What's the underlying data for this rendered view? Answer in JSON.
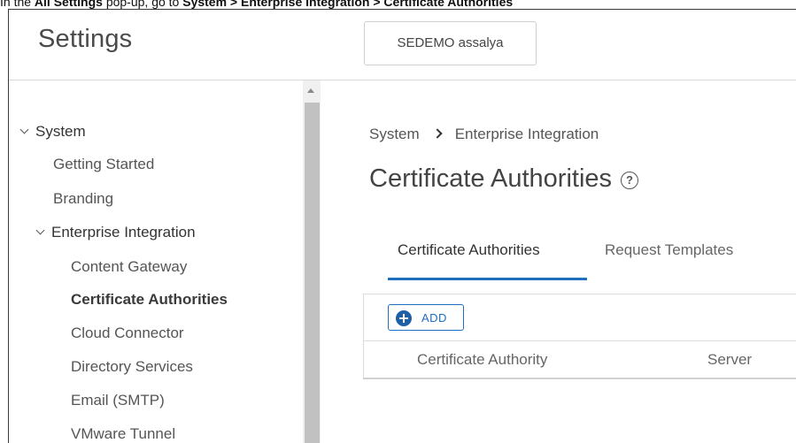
{
  "instruction": {
    "prefix": "In the ",
    "bold1": "All Settings",
    "middle": " pop-up, go to ",
    "bold2": "System > Enterprise Integration > Certificate Authorities"
  },
  "header": {
    "title": "Settings",
    "org_button": "SEDEMO assalya"
  },
  "sidebar": {
    "items": [
      {
        "label": "System",
        "level": 0,
        "expanded": true
      },
      {
        "label": "Getting Started",
        "level": 1
      },
      {
        "label": "Branding",
        "level": 1
      },
      {
        "label": "Enterprise Integration",
        "level": 1,
        "expanded": true
      },
      {
        "label": "Content Gateway",
        "level": 2
      },
      {
        "label": "Certificate Authorities",
        "level": 2,
        "active": true
      },
      {
        "label": "Cloud Connector",
        "level": 2
      },
      {
        "label": "Directory Services",
        "level": 2
      },
      {
        "label": "Email (SMTP)",
        "level": 2
      },
      {
        "label": "VMware Tunnel",
        "level": 2
      }
    ]
  },
  "main": {
    "breadcrumb": [
      "System",
      "Enterprise Integration"
    ],
    "page_title": "Certificate Authorities",
    "tabs": [
      {
        "label": "Certificate Authorities",
        "active": true
      },
      {
        "label": "Request Templates",
        "active": false
      }
    ],
    "add_button": "ADD",
    "columns": [
      "Certificate Authority",
      "Server"
    ]
  },
  "colors": {
    "accent": "#1f6fbf",
    "scrollbar_thumb": "#c1c1c1"
  },
  "icons": {
    "help": "question-circle-icon",
    "add": "plus-circle-icon",
    "breadcrumb_sep": "chevron-right-icon",
    "expand": "chevron-down-icon"
  }
}
